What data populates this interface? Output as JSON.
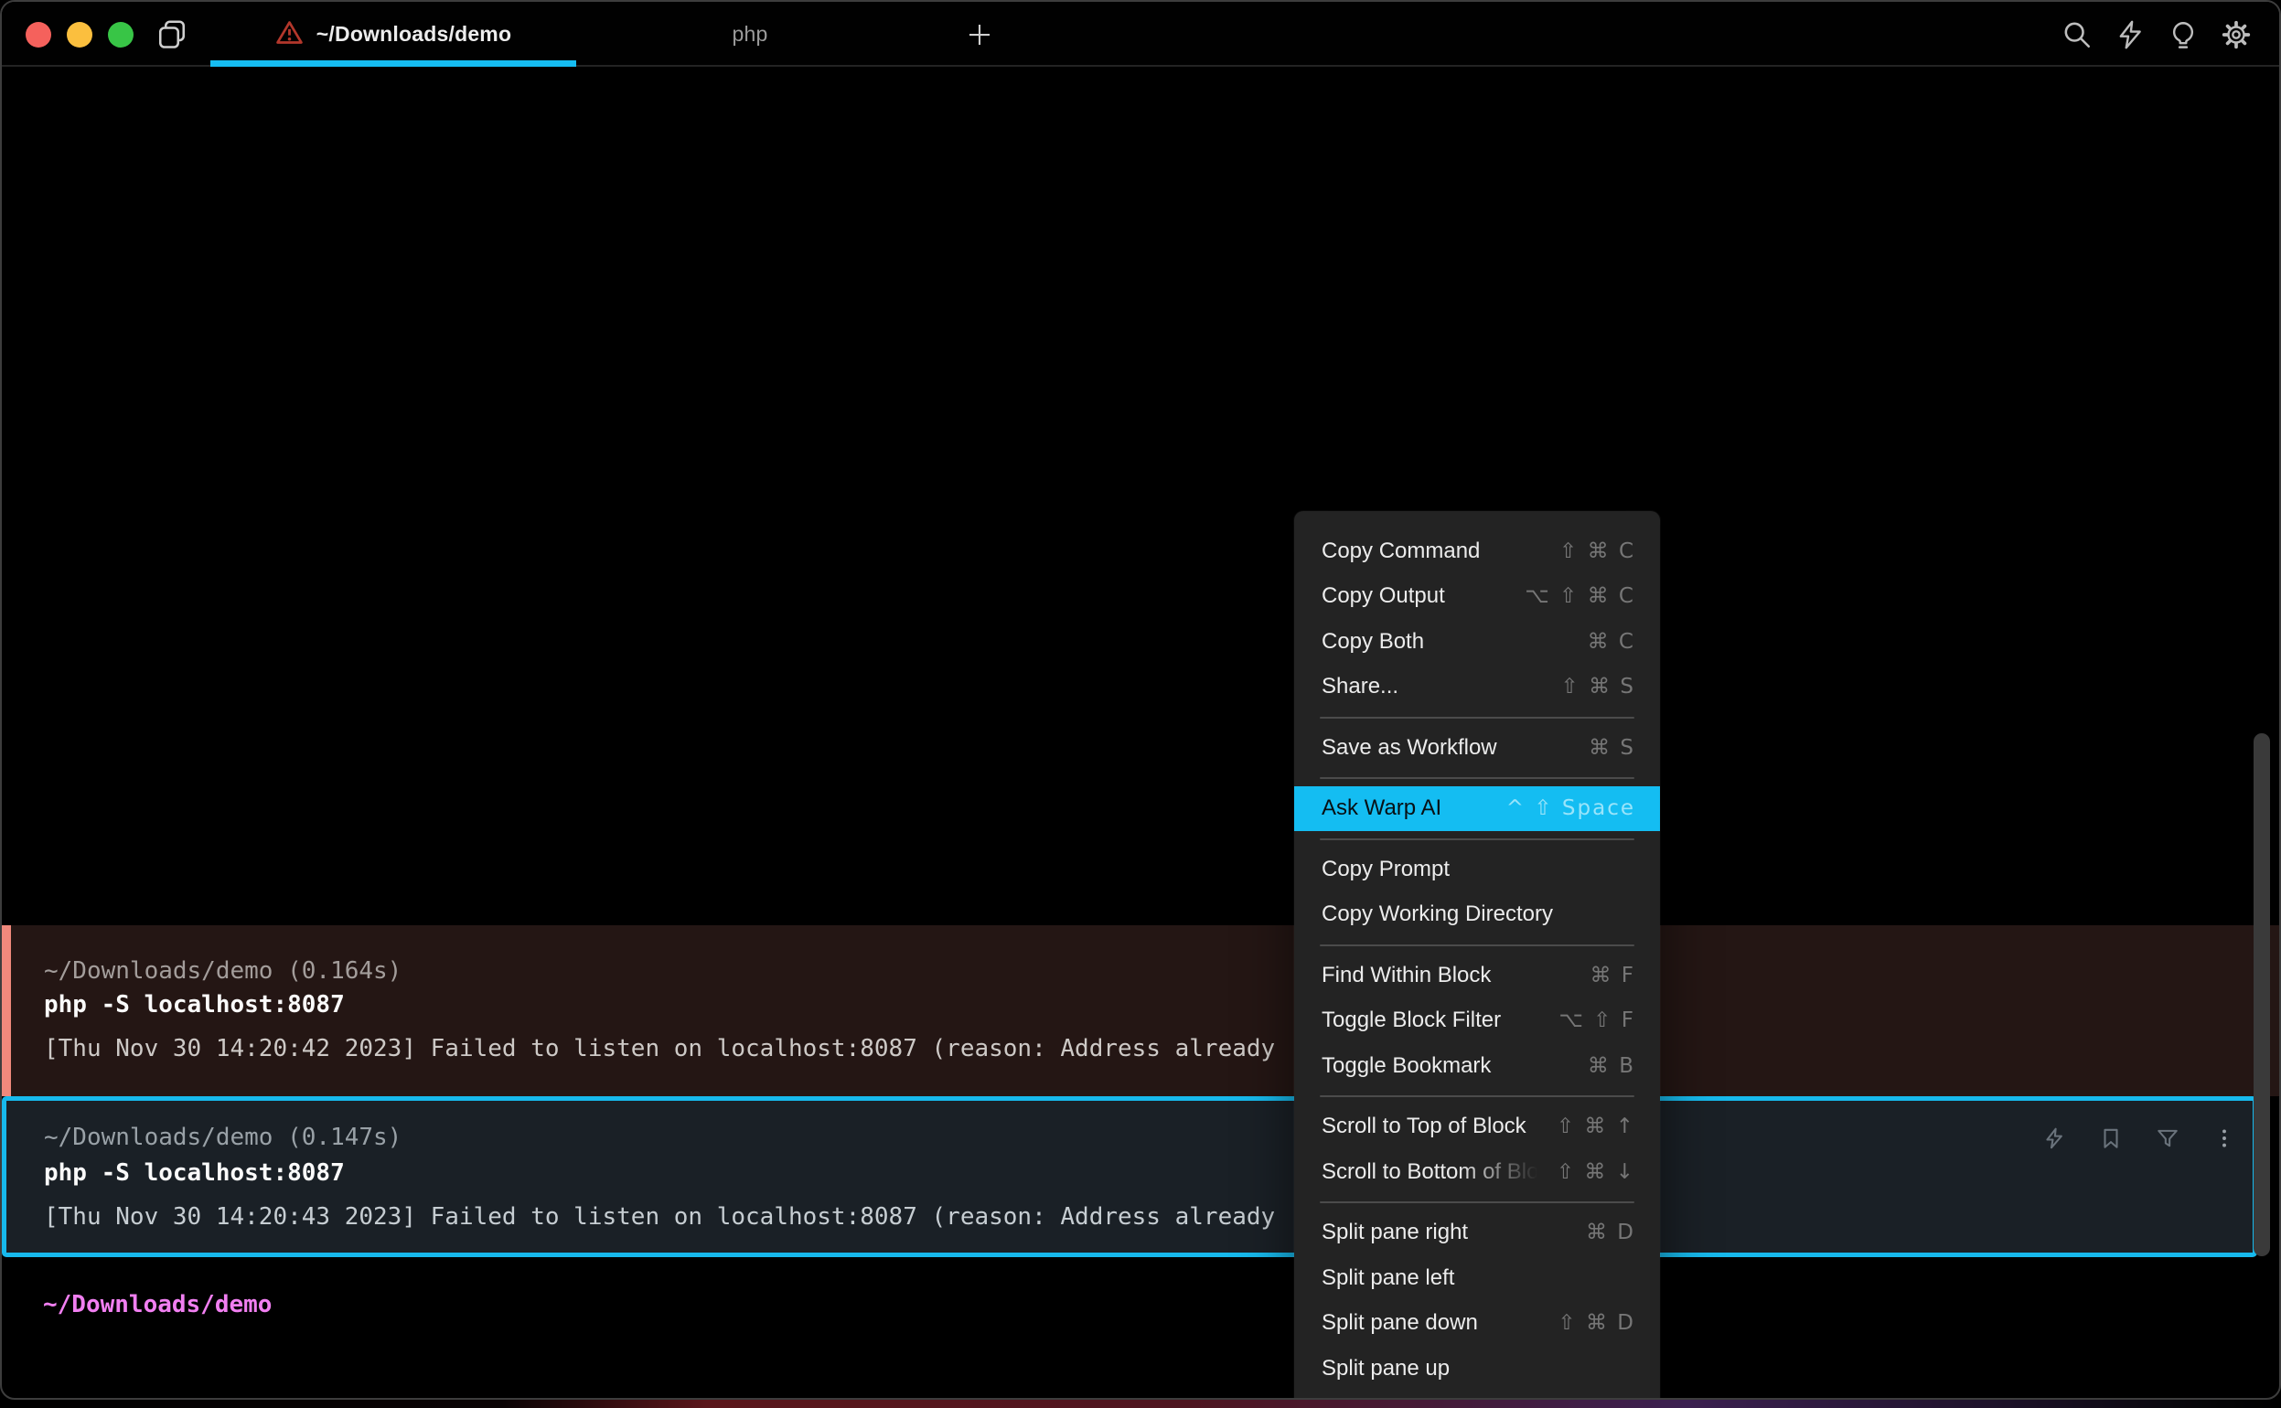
{
  "colors": {
    "accent_cyan": "#16BDF2",
    "error_red_border": "#F0897C",
    "selected_block_border": "#17B9EC",
    "prompt_pink": "#F17FF1",
    "warning_triangle_red": "#B3372B",
    "traffic_red": "#F5615C",
    "traffic_yellow": "#FBBF3E",
    "traffic_green": "#38C546"
  },
  "tabbar": {
    "tabs": [
      {
        "title": "~/Downloads/demo",
        "active": true,
        "has_warning": true
      },
      {
        "title": "php",
        "active": false,
        "has_warning": false
      }
    ],
    "new_tab_label": "+",
    "left_icons": [
      "book"
    ],
    "right_icons": [
      "search",
      "lightning",
      "lightbulb",
      "gear"
    ]
  },
  "blocks": [
    {
      "meta": "~/Downloads/demo (0.164s)",
      "command": "php -S localhost:8087",
      "output": "[Thu Nov 30 14:20:42 2023] Failed to listen on localhost:8087 (reason: Address already",
      "state": "error"
    },
    {
      "meta": "~/Downloads/demo (0.147s)",
      "command": "php -S localhost:8087",
      "output": "[Thu Nov 30 14:20:43 2023] Failed to listen on localhost:8087 (reason: Address already",
      "state": "selected",
      "toolbar_icons": [
        "lightning",
        "bookmark",
        "filter",
        "kebab"
      ]
    }
  ],
  "prompt": {
    "path": "~/Downloads/demo"
  },
  "context_menu": {
    "groups": [
      {
        "items": [
          {
            "label": "Copy Command",
            "shortcut": "⇧ ⌘ C"
          },
          {
            "label": "Copy Output",
            "shortcut": "⌥ ⇧ ⌘ C"
          },
          {
            "label": "Copy Both",
            "shortcut": "⌘ C"
          },
          {
            "label": "Share...",
            "shortcut": "⇧ ⌘ S"
          }
        ]
      },
      {
        "items": [
          {
            "label": "Save as Workflow",
            "shortcut": "⌘ S"
          }
        ]
      },
      {
        "items": [
          {
            "label": "Ask Warp AI",
            "shortcut": "^ ⇧ Space",
            "highlighted": true
          }
        ]
      },
      {
        "items": [
          {
            "label": "Copy Prompt"
          },
          {
            "label": "Copy Working Directory"
          }
        ]
      },
      {
        "items": [
          {
            "label": "Find Within Block",
            "shortcut": "⌘ F"
          },
          {
            "label": "Toggle Block Filter",
            "shortcut": "⌥ ⇧ F"
          },
          {
            "label": "Toggle Bookmark",
            "shortcut": "⌘ B"
          }
        ]
      },
      {
        "items": [
          {
            "label": "Scroll to Top of Block",
            "shortcut": "⇧ ⌘ ↑"
          },
          {
            "label": "Scroll to Bottom of Block",
            "shortcut": "⇧ ⌘ ↓",
            "label_fade": true
          }
        ]
      },
      {
        "items": [
          {
            "label": "Split pane right",
            "shortcut": "⌘ D"
          },
          {
            "label": "Split pane left"
          },
          {
            "label": "Split pane down",
            "shortcut": "⇧ ⌘ D"
          },
          {
            "label": "Split pane up"
          }
        ]
      }
    ]
  }
}
